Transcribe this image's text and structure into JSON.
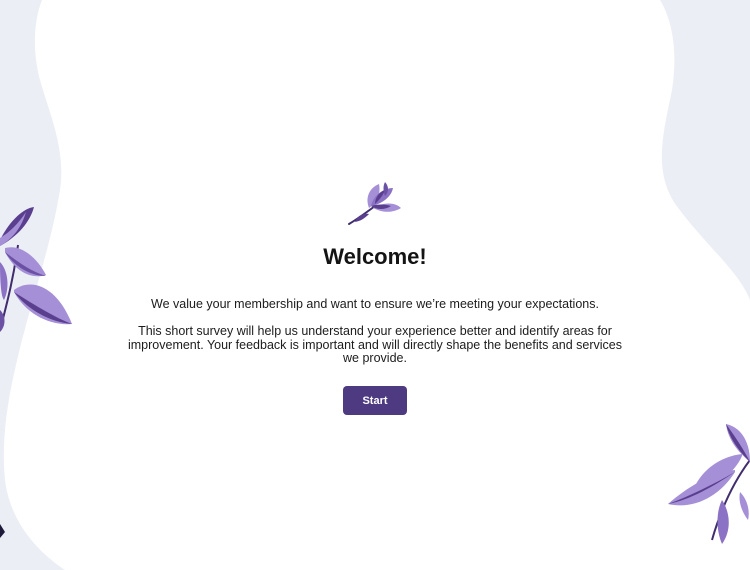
{
  "welcome": {
    "title": "Welcome!",
    "intro": "We value your membership and want to ensure we’re meeting your expectations.",
    "description": "This short survey will help us understand your experience better and identify areas for improvement. Your feedback is important and will directly shape the benefits and services we provide.",
    "start_label": "Start"
  },
  "colors": {
    "background": "#eceef5",
    "card": "#ffffff",
    "accent": "#4e3a80",
    "leaf_light": "#a58fd6",
    "leaf_dark": "#5a3f8f"
  },
  "icons": {
    "logo": "lotus-flower-icon",
    "decor_left": "leaf-branch-icon",
    "decor_right": "leaf-branch-icon"
  }
}
